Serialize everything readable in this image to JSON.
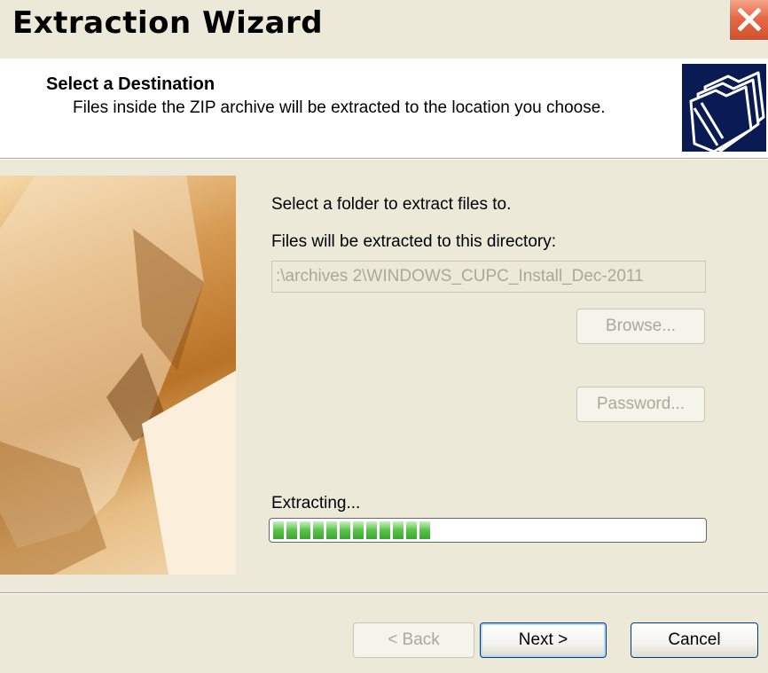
{
  "window": {
    "title": "Extraction Wizard",
    "close_icon": "close-x-icon",
    "close_color": "#e0573a"
  },
  "header": {
    "title": "Select a Destination",
    "description": "Files inside the ZIP archive will be extracted to the location you choose.",
    "icon": "folders-icon"
  },
  "main": {
    "select_label": "Select a folder to extract files to.",
    "dest_label": "Files will be extracted to this directory:",
    "dest_value": ":\\archives 2\\WINDOWS_CUPC_Install_Dec-2011",
    "browse_label": "Browse...",
    "password_label": "Password...",
    "status_label": "Extracting...",
    "progress_fraction": 0.38,
    "progress_color": "#4cba3c"
  },
  "footer": {
    "back_label": "< Back",
    "next_label": "Next >",
    "cancel_label": "Cancel"
  }
}
